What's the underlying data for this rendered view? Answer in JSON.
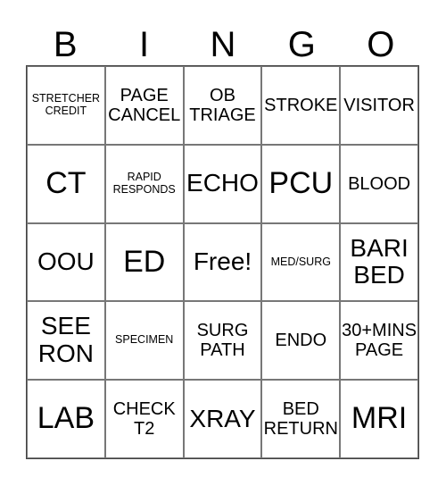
{
  "header": [
    "B",
    "I",
    "N",
    "G",
    "O"
  ],
  "cells": [
    [
      "STRETCHER CREDIT",
      "PAGE CANCEL",
      "OB TRIAGE",
      "STROKE",
      "VISITOR"
    ],
    [
      "CT",
      "RAPID RESPONDS",
      "ECHO",
      "PCU",
      "BLOOD"
    ],
    [
      "OOU",
      "ED",
      "Free!",
      "MED/SURG",
      "BARI BED"
    ],
    [
      "SEE RON",
      "SPECIMEN",
      "SURG PATH",
      "ENDO",
      "30+MINS PAGE"
    ],
    [
      "LAB",
      "CHECK T2",
      "XRAY",
      "BED RETURN",
      "MRI"
    ]
  ]
}
